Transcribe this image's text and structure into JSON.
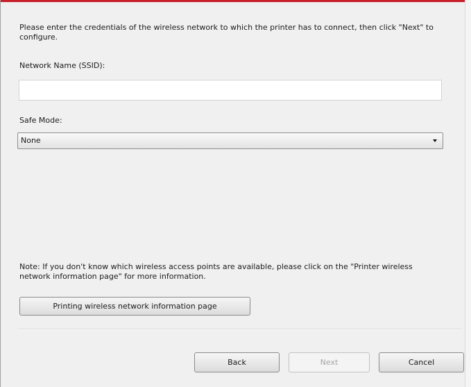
{
  "intro_text": "Please enter the credentials of the wireless network to which the printer has to connect, then click \"Next\" to configure.",
  "network_name": {
    "label": "Network Name (SSID):",
    "value": "",
    "placeholder": ""
  },
  "safe_mode": {
    "label": "Safe Mode:",
    "selected": "None"
  },
  "note_text": "Note: If you don't know which wireless access points are available, please click on the \"Printer wireless network information page\" for more information.",
  "buttons": {
    "print_info": "Printing wireless network information page",
    "back": "Back",
    "next": "Next",
    "cancel": "Cancel"
  },
  "colors": {
    "accent": "#c8202a"
  }
}
